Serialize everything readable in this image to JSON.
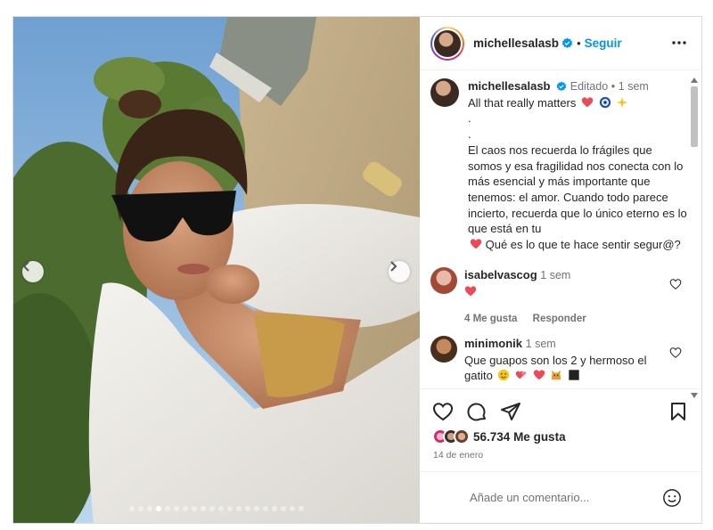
{
  "post": {
    "username": "michellesalasb",
    "follow_label": "Seguir",
    "separator": "•",
    "edited_label": "Editado",
    "time_ago": "1 sem",
    "caption_first": "All that really matters",
    "caption_body": ".\n.\nEl caos nos recuerda lo frágiles que somos y esa fragilidad nos conecta con lo más esencial y más importante que tenemos: el amor. Cuando todo parece incierto, recuerda que lo único eterno es lo que está en tu",
    "caption_tail": "Qué es lo que te hace sentir segur@?",
    "likes_count": "56.734",
    "likes_label": "Me gusta",
    "date": "14 de enero",
    "comment_placeholder": "Añade un comentario...",
    "carousel_total": 20,
    "carousel_active": 4
  },
  "comments": [
    {
      "username": "isabelvascog",
      "time_ago": "1 sem",
      "likes": "4 Me gusta",
      "reply_label": "Responder"
    },
    {
      "username": "minimonik",
      "time_ago": "1 sem",
      "text": "Que guapos son los 2 y hermoso el gatito"
    }
  ],
  "icons": {
    "verified": "verified-badge-icon",
    "more": "more-options-icon",
    "heart": "heart-icon",
    "comment": "comment-icon",
    "share": "share-icon",
    "save": "bookmark-icon",
    "emoji": "smiley-icon"
  },
  "colors": {
    "accent": "#0095f6",
    "heart": "#ed4956",
    "muted": "#737373"
  }
}
